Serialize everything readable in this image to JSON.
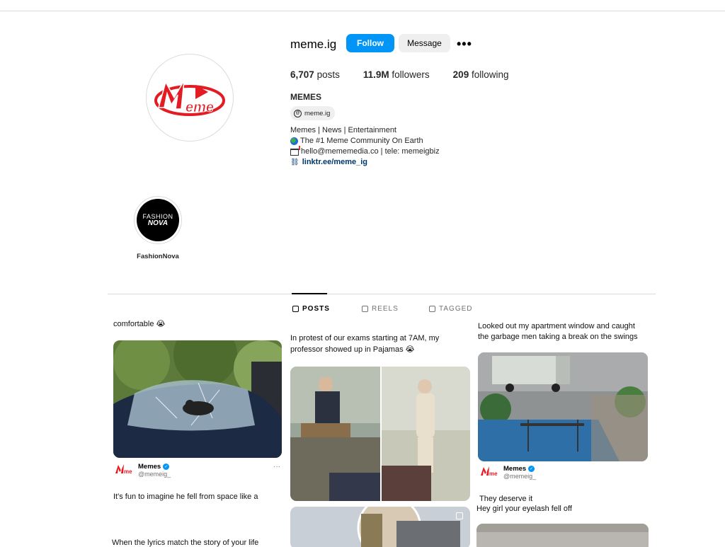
{
  "profile": {
    "username": "meme.ig",
    "follow_label": "Follow",
    "message_label": "Message",
    "more_label": "•••",
    "stats": [
      {
        "count": "6,707",
        "label": "posts"
      },
      {
        "count": "11.9M",
        "label": "followers"
      },
      {
        "count": "209",
        "label": "following"
      }
    ],
    "full_name": "MEMES",
    "threads_handle": "meme.ig",
    "threads_icon": "@",
    "bio": {
      "line1": "Memes | News | Entertainment",
      "line2": "The #1 Meme Community On Earth",
      "line3": "hello@mememedia.co | tele: memeigbiz",
      "link": "linktr.ee/meme_ig"
    },
    "avatar_logo_text": "Meme"
  },
  "highlight": {
    "logo_line1": "FASHION",
    "logo_line2": "NOVA",
    "label": "FashionNova"
  },
  "tabs": {
    "posts": "POSTS",
    "reels": "REELS",
    "tagged": "TAGGED"
  },
  "posts": {
    "col1": {
      "top_caption": "comfortable 😭",
      "author_name": "Memes",
      "author_handle": "@memeig_",
      "more": "···",
      "caption": "It's fun to imagine he fell from space like a",
      "next_caption": "When the lyrics match the story of your life"
    },
    "col2": {
      "caption_line1": "In protest of our exams starting at 7AM, my",
      "caption_line2": "professor showed up in Pajamas 😭"
    },
    "col3": {
      "top_line1": "Looked out my apartment window and caught",
      "top_line2": "the garbage men taking a break on the swings",
      "author_name": "Memes",
      "author_handle": "@memeig_",
      "caption": "They deserve it",
      "next_caption": "Hey girl your eyelash fell off"
    }
  },
  "colors": {
    "follow_blue": "#0095f6",
    "link_blue": "#00376b",
    "brand_red": "#e31b23"
  }
}
